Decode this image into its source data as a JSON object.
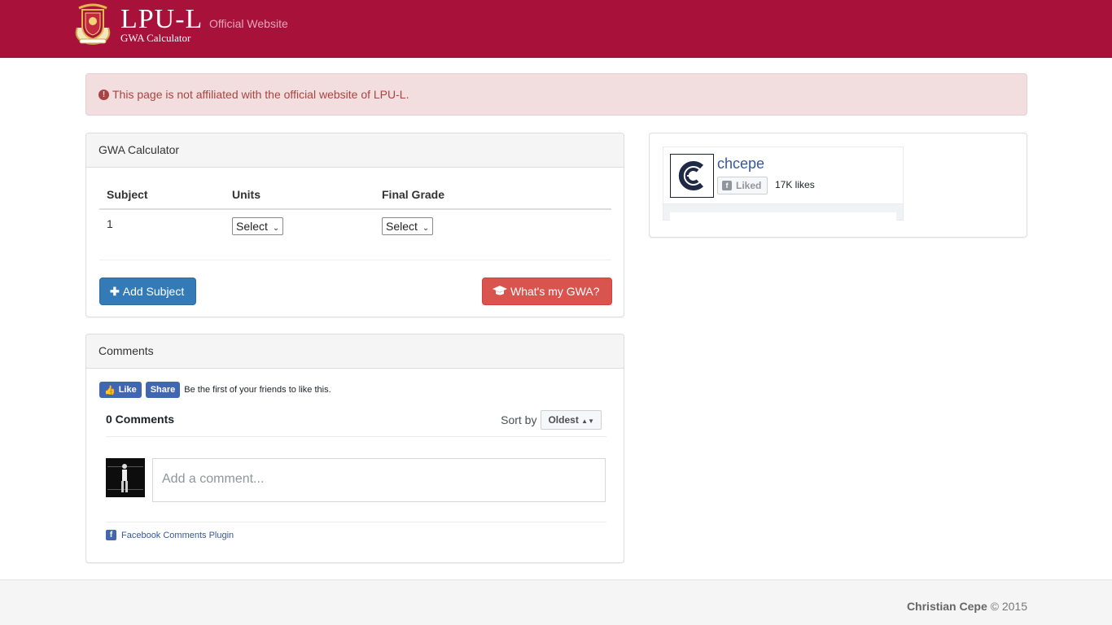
{
  "navbar": {
    "brand_title": "LPU-L",
    "brand_subtitle": "GWA Calculator",
    "link": "Official Website",
    "color": "#a8113a"
  },
  "alert": {
    "icon": "exclamation-circle-icon",
    "text": "This page is not affiliated with the official website of LPU-L."
  },
  "calculator": {
    "heading": "GWA Calculator",
    "columns": [
      "Subject",
      "Units",
      "Final Grade"
    ],
    "rows": [
      {
        "subject": "1",
        "units": "Select",
        "final_grade": "Select"
      }
    ],
    "add_button": "Add Subject",
    "add_icon": "plus-icon",
    "gwa_button": "What's my GWA?",
    "gwa_icon": "graduation-cap-icon"
  },
  "comments": {
    "heading": "Comments",
    "like_label": "Like",
    "share_label": "Share",
    "like_text": "Be the first of your friends to like this.",
    "count": "0 Comments",
    "sort_label": "Sort by",
    "sort_value": "Oldest",
    "placeholder": "Add a comment...",
    "plugin_label": "Facebook Comments Plugin"
  },
  "page_plugin": {
    "name": "chcepe",
    "liked_label": "Liked",
    "likes": "17K likes"
  },
  "footer": {
    "author": "Christian Cepe",
    "copyright": "© 2015"
  }
}
